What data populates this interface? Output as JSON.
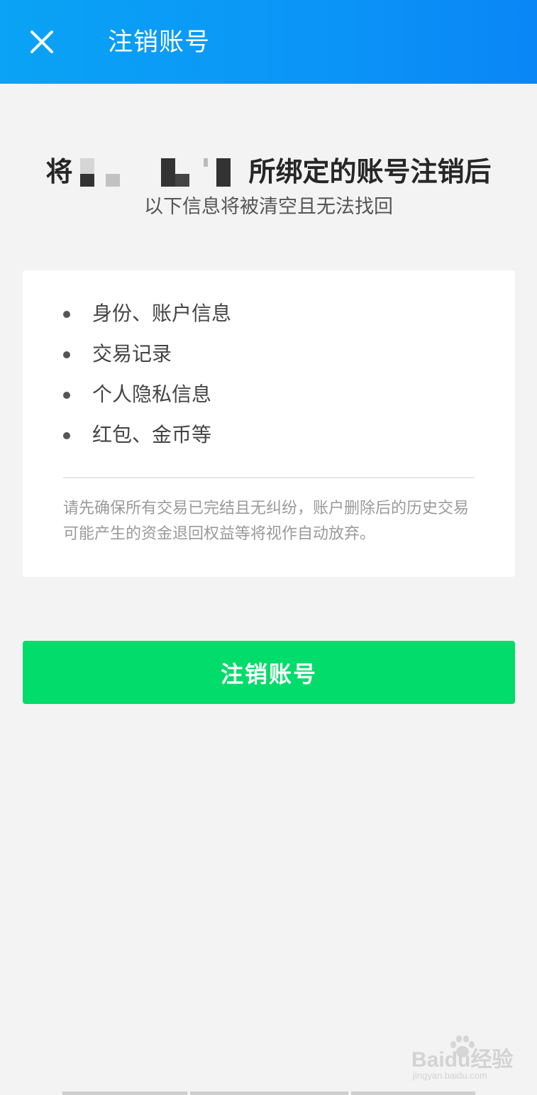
{
  "header": {
    "title": "注销账号",
    "close_icon": "close-icon",
    "background": "#0a96f6"
  },
  "headline": {
    "prefix": "将",
    "suffix": "所绑定的账号注销后",
    "subline": "以下信息将被清空且无法找回"
  },
  "info_card": {
    "items": [
      {
        "label": "身份、账户信息"
      },
      {
        "label": "交易记录"
      },
      {
        "label": "个人隐私信息"
      },
      {
        "label": "红包、金币等"
      }
    ],
    "note": "请先确保所有交易已完结且无纠纷，账户删除后的历史交易可能产生的资金退回权益等将视作自动放弃。"
  },
  "primary_button": {
    "label": "注销账号",
    "color": "#02dc6a"
  },
  "watermark": {
    "main": "Baidu经验",
    "sub": "jingyan.baidu.com"
  }
}
